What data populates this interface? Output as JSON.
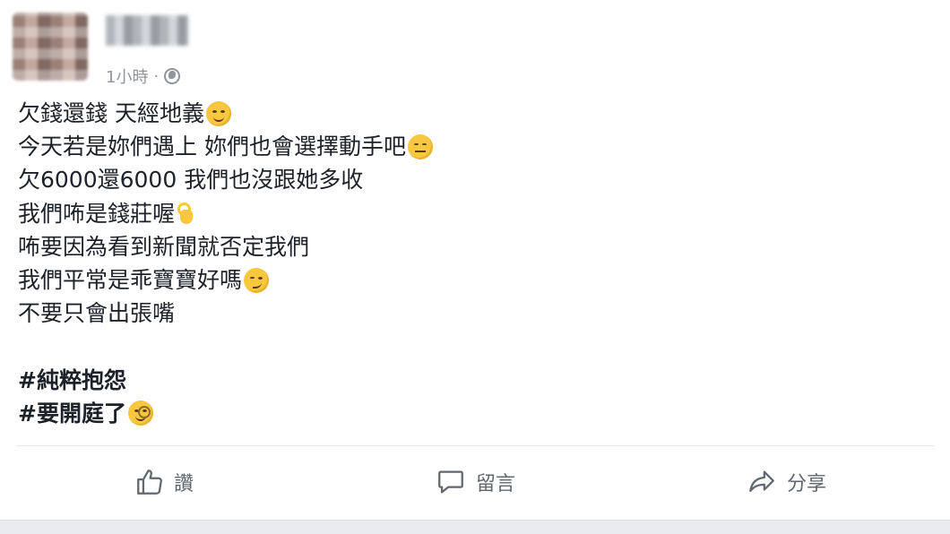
{
  "post": {
    "time": "1小時",
    "separator": "·",
    "privacy_icon": "globe-icon",
    "lines": [
      {
        "text": "欠錢還錢 天經地義",
        "emoji": "smiling-face-icon"
      },
      {
        "text": "今天若是妳們遇上 妳們也會選擇動手吧",
        "emoji": "expressionless-face-icon"
      },
      {
        "text": "欠6000還6000 我們也沒跟她多收",
        "emoji": ""
      },
      {
        "text": "我們咘是錢莊喔",
        "emoji": "ok-hand-icon"
      },
      {
        "text": "咘要因為看到新聞就否定我們",
        "emoji": ""
      },
      {
        "text": "我們平常是乖寶寶好嗎",
        "emoji": "smirking-face-icon"
      },
      {
        "text": "不要只會出張嘴",
        "emoji": ""
      }
    ],
    "hashtags": [
      {
        "text": "#純粹抱怨",
        "emoji": ""
      },
      {
        "text": "#要開庭了",
        "emoji": "monocle-face-icon"
      }
    ]
  },
  "actions": {
    "like_label": "讚",
    "comment_label": "留言",
    "share_label": "分享"
  }
}
